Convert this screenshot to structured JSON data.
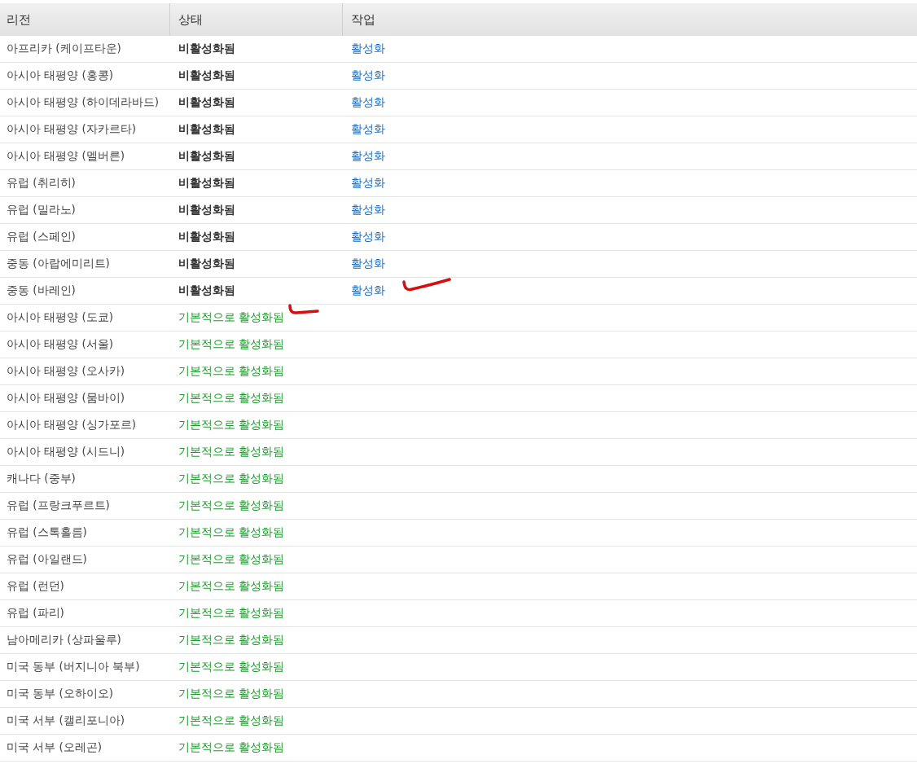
{
  "table": {
    "columns": [
      "리전",
      "상태",
      "작업"
    ],
    "rows": [
      {
        "region": "아프리카 (케이프타운)",
        "status": "비활성화됨",
        "kind": "disabled",
        "action": "활성화"
      },
      {
        "region": "아시아 태평양 (홍콩)",
        "status": "비활성화됨",
        "kind": "disabled",
        "action": "활성화"
      },
      {
        "region": "아시아 태평양 (하이데라바드)",
        "status": "비활성화됨",
        "kind": "disabled",
        "action": "활성화"
      },
      {
        "region": "아시아 태평양 (자카르타)",
        "status": "비활성화됨",
        "kind": "disabled",
        "action": "활성화"
      },
      {
        "region": "아시아 태평양 (멜버른)",
        "status": "비활성화됨",
        "kind": "disabled",
        "action": "활성화"
      },
      {
        "region": "유럽 (취리히)",
        "status": "비활성화됨",
        "kind": "disabled",
        "action": "활성화"
      },
      {
        "region": "유럽 (밀라노)",
        "status": "비활성화됨",
        "kind": "disabled",
        "action": "활성화"
      },
      {
        "region": "유럽 (스페인)",
        "status": "비활성화됨",
        "kind": "disabled",
        "action": "활성화"
      },
      {
        "region": "중동 (아랍에미리트)",
        "status": "비활성화됨",
        "kind": "disabled",
        "action": "활성화"
      },
      {
        "region": "중동 (바레인)",
        "status": "비활성화됨",
        "kind": "disabled",
        "action": "활성화"
      },
      {
        "region": "아시아 태평양 (도쿄)",
        "status": "기본적으로 활성화됨",
        "kind": "default"
      },
      {
        "region": "아시아 태평양 (서울)",
        "status": "기본적으로 활성화됨",
        "kind": "default"
      },
      {
        "region": "아시아 태평양 (오사카)",
        "status": "기본적으로 활성화됨",
        "kind": "default"
      },
      {
        "region": "아시아 태평양 (뭄바이)",
        "status": "기본적으로 활성화됨",
        "kind": "default"
      },
      {
        "region": "아시아 태평양 (싱가포르)",
        "status": "기본적으로 활성화됨",
        "kind": "default"
      },
      {
        "region": "아시아 태평양 (시드니)",
        "status": "기본적으로 활성화됨",
        "kind": "default"
      },
      {
        "region": "캐나다 (중부)",
        "status": "기본적으로 활성화됨",
        "kind": "default"
      },
      {
        "region": "유럽 (프랑크푸르트)",
        "status": "기본적으로 활성화됨",
        "kind": "default"
      },
      {
        "region": "유럽 (스톡홀름)",
        "status": "기본적으로 활성화됨",
        "kind": "default"
      },
      {
        "region": "유럽 (아일랜드)",
        "status": "기본적으로 활성화됨",
        "kind": "default"
      },
      {
        "region": "유럽 (런던)",
        "status": "기본적으로 활성화됨",
        "kind": "default"
      },
      {
        "region": "유럽 (파리)",
        "status": "기본적으로 활성화됨",
        "kind": "default"
      },
      {
        "region": "남아메리카 (상파울루)",
        "status": "기본적으로 활성화됨",
        "kind": "default"
      },
      {
        "region": "미국 동부 (버지니아 북부)",
        "status": "기본적으로 활성화됨",
        "kind": "default"
      },
      {
        "region": "미국 동부 (오하이오)",
        "status": "기본적으로 활성화됨",
        "kind": "default"
      },
      {
        "region": "미국 서부 (캘리포니아)",
        "status": "기본적으로 활성화됨",
        "kind": "default"
      },
      {
        "region": "미국 서부 (오레곤)",
        "status": "기본적으로 활성화됨",
        "kind": "default"
      }
    ]
  }
}
